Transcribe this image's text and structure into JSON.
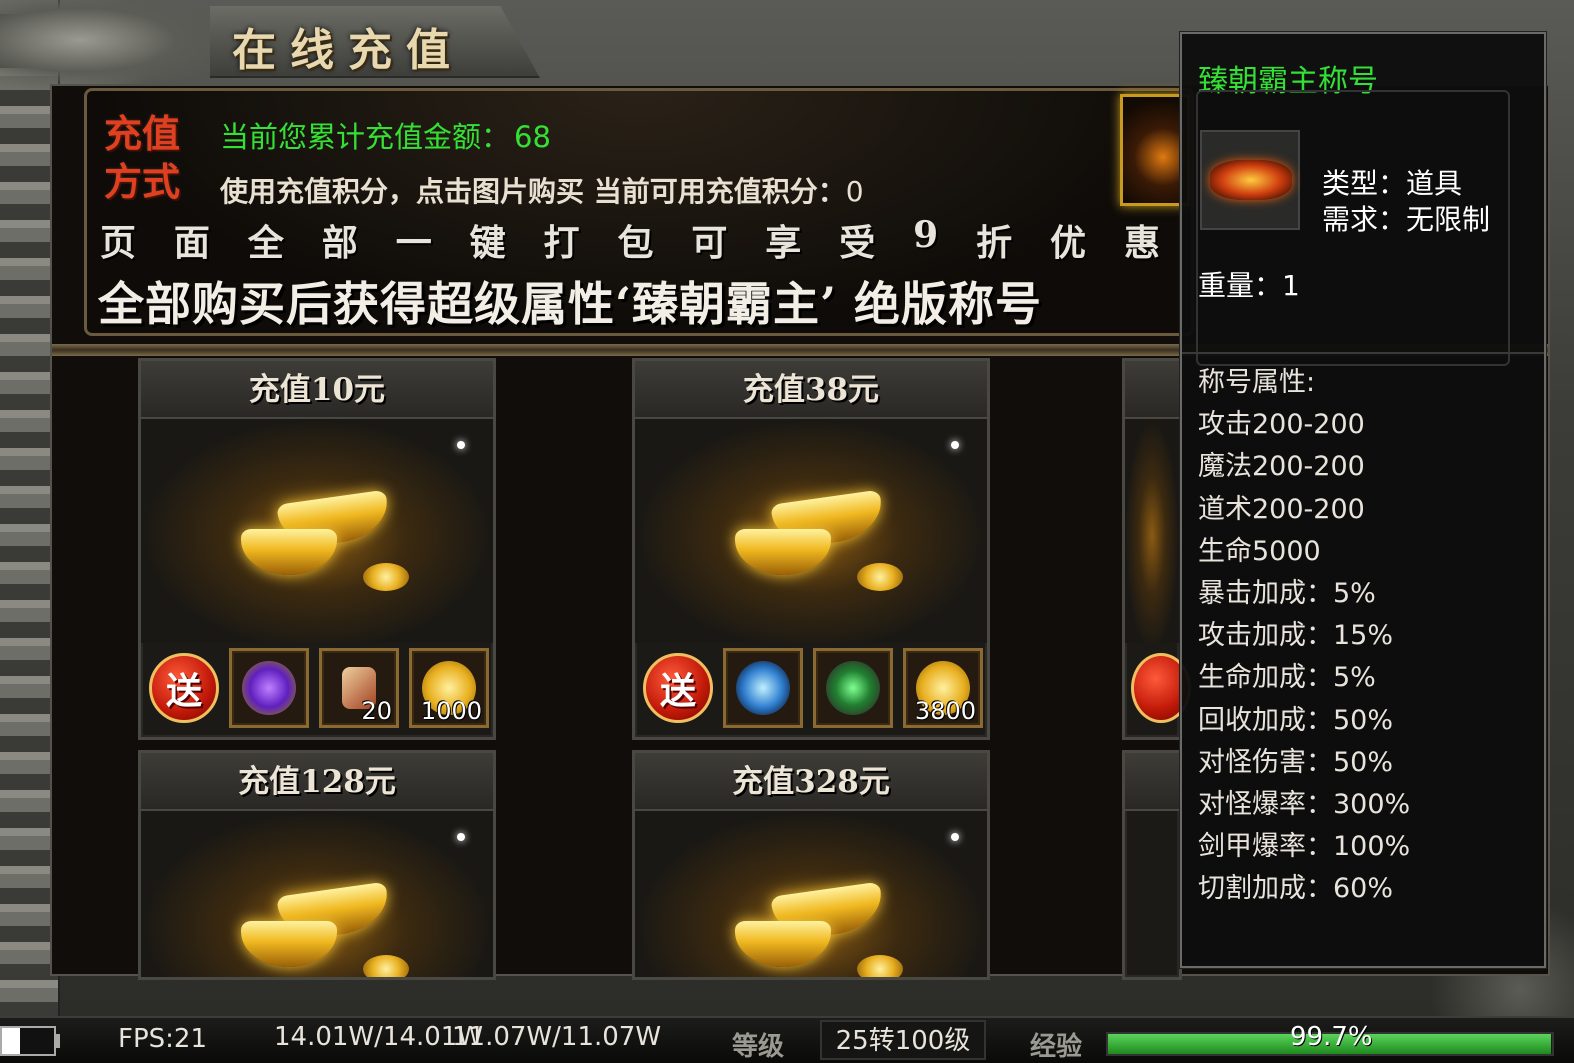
{
  "window": {
    "title": "在线充值"
  },
  "header": {
    "method_label": "充值方式",
    "total_label": "当前您累计充值金额：",
    "total_value": "68",
    "points_text": "使用充值积分，点击图片购买 当前可用充值积分：",
    "points_value": "0",
    "discount_chars": [
      "页",
      "面",
      "全",
      "部",
      "一",
      "键",
      "打",
      "包",
      "可",
      "享",
      "受",
      "9",
      "折",
      "优",
      "惠"
    ],
    "reward_text": "全部购买后获得超级属性‘臻朝霸主’ 绝版称号"
  },
  "packages": [
    {
      "title": "充值10元",
      "gift_label": "送",
      "items": [
        {
          "icon": "purple-gem-icon",
          "qty": ""
        },
        {
          "icon": "scroll-icon",
          "qty": "20"
        },
        {
          "icon": "gold-coins-icon",
          "qty": "1000"
        }
      ]
    },
    {
      "title": "充值38元",
      "gift_label": "送",
      "items": [
        {
          "icon": "blue-orb-icon",
          "qty": ""
        },
        {
          "icon": "jade-pendant-icon",
          "qty": ""
        },
        {
          "icon": "gold-coins-icon",
          "qty": "3800"
        }
      ]
    },
    {
      "title": "充值128元"
    },
    {
      "title": "充值328元"
    }
  ],
  "tooltip": {
    "name": "臻朝霸主称号",
    "type": "类型：道具",
    "requirement": "需求：无限制",
    "weight": "重量：1",
    "attributes_title": "称号属性:",
    "attributes": [
      "攻击200-200",
      "魔法200-200",
      "道术200-200",
      "生命5000",
      "暴击加成：5%",
      "攻击加成：15%",
      "生命加成：5%",
      "回收加成：50%",
      "对怪伤害：50%",
      "对怪爆率：300%",
      "剑甲爆率：100%",
      "切割加成：60%"
    ]
  },
  "status": {
    "fps": "FPS:21",
    "hp": "14.01W/14.01W",
    "mp": "11.07W/11.07W",
    "level_label": "等级",
    "level": "25转100级",
    "exp_label": "经验",
    "exp": "99.7%",
    "exp_fraction": 0.997,
    "battery_fraction": 0.35
  },
  "colors": {
    "green": "#35e035",
    "gold_border": "#c89a20",
    "gift_red": "#c01808"
  }
}
